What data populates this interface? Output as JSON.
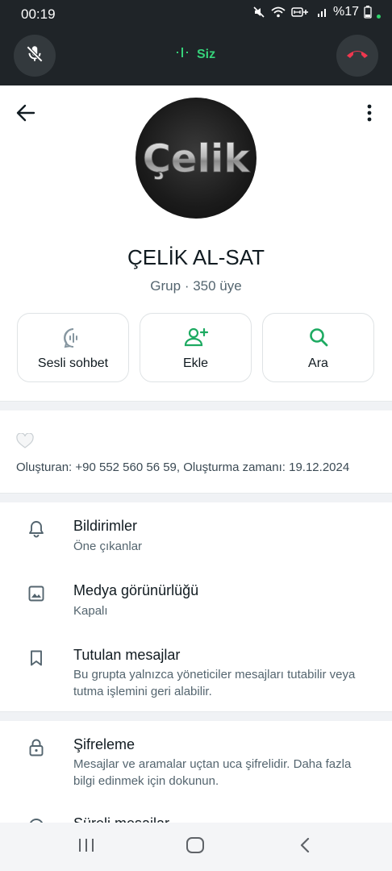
{
  "status_bar": {
    "time": "00:19",
    "battery": "%17"
  },
  "call_bar": {
    "speaker_label": "Siz",
    "colors": {
      "speaking": "#36d27a",
      "end_call": "#f0374f"
    }
  },
  "group": {
    "name": "ÇELİK AL-SAT",
    "subtitle": "Grup · 350 üye",
    "avatar_text": "Çelik"
  },
  "actions": [
    {
      "label": "Sesli sohbet",
      "icon": "voice-chat-icon"
    },
    {
      "label": "Ekle",
      "icon": "add-person-icon"
    },
    {
      "label": "Ara",
      "icon": "search-icon"
    }
  ],
  "description": {
    "created_text": "Oluşturan: +90 552 560 56 59, Oluşturma zamanı: 19.12.2024"
  },
  "settings": [
    {
      "title": "Bildirimler",
      "subtitle": "Öne çıkanlar",
      "icon": "bell-icon"
    },
    {
      "title": "Medya görünürlüğü",
      "subtitle": "Kapalı",
      "icon": "image-icon"
    },
    {
      "title": "Tutulan mesajlar",
      "subtitle": "Bu grupta yalnızca yöneticiler mesajları tutabilir veya tutma işlemini geri alabilir.",
      "icon": "bookmark-icon"
    },
    {
      "title": "Şifreleme",
      "subtitle": "Mesajlar ve aramalar uçtan uca şifrelidir. Daha fazla bilgi edinmek için dokunun.",
      "icon": "lock-icon"
    },
    {
      "title": "Süreli mesajlar",
      "icon": "timer-icon"
    }
  ],
  "accent_color": "#1daa61"
}
